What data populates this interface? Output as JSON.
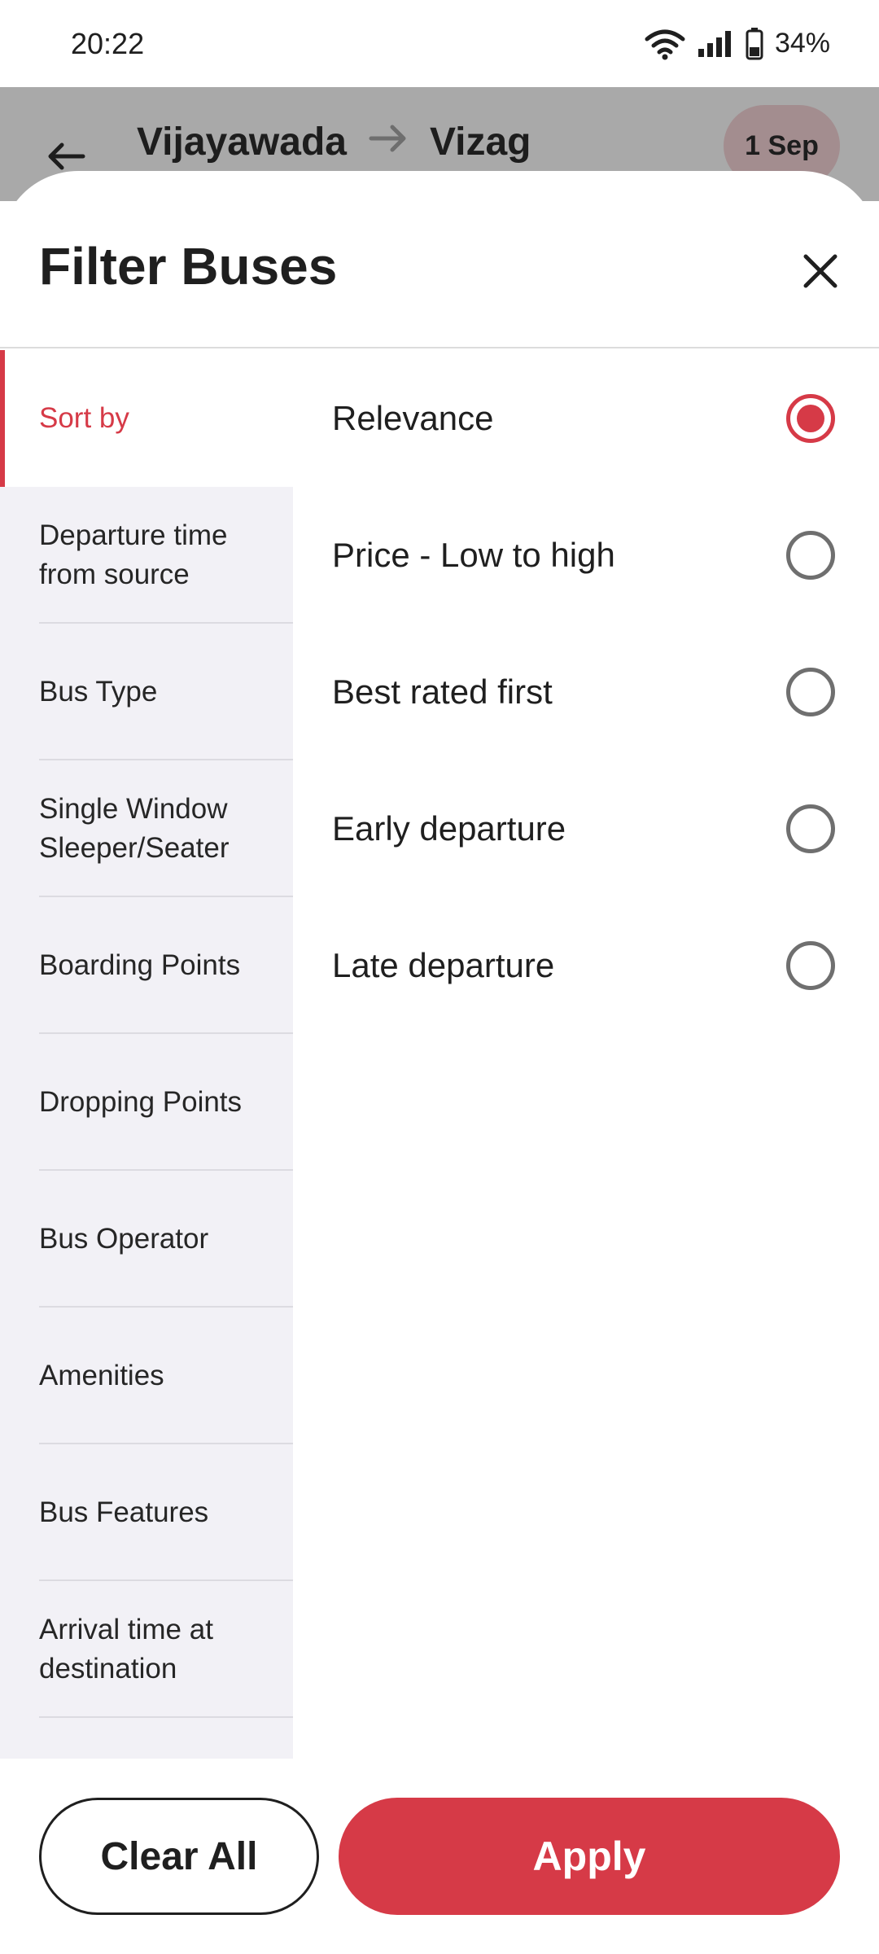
{
  "status_bar": {
    "time": "20:22",
    "battery": "34%",
    "icons": [
      "wifi-icon",
      "signal-icon",
      "battery-icon"
    ]
  },
  "background_header": {
    "back_icon": "arrow-left-icon",
    "origin": "Vijayawada",
    "destination": "Vizag",
    "date_chip": "1 Sep"
  },
  "sheet": {
    "title": "Filter Buses",
    "close_icon": "close-icon",
    "categories": [
      {
        "label": "Sort by",
        "active": true
      },
      {
        "label": "Departure time from source",
        "active": false
      },
      {
        "label": "Bus Type",
        "active": false
      },
      {
        "label": "Single Window Sleeper/Seater",
        "active": false
      },
      {
        "label": "Boarding Points",
        "active": false
      },
      {
        "label": "Dropping Points",
        "active": false
      },
      {
        "label": "Bus Operator",
        "active": false
      },
      {
        "label": "Amenities",
        "active": false
      },
      {
        "label": "Bus Features",
        "active": false
      },
      {
        "label": "Arrival time at destination",
        "active": false
      }
    ],
    "sort_options": [
      {
        "label": "Relevance",
        "selected": true
      },
      {
        "label": "Price - Low to high",
        "selected": false
      },
      {
        "label": "Best rated first",
        "selected": false
      },
      {
        "label": "Early departure",
        "selected": false
      },
      {
        "label": "Late departure",
        "selected": false
      }
    ]
  },
  "footer": {
    "clear_label": "Clear All",
    "apply_label": "Apply"
  },
  "colors": {
    "accent": "#d63a47",
    "sidebar_bg": "#f2f1f6",
    "scrim_header": "#a9a9a9"
  }
}
